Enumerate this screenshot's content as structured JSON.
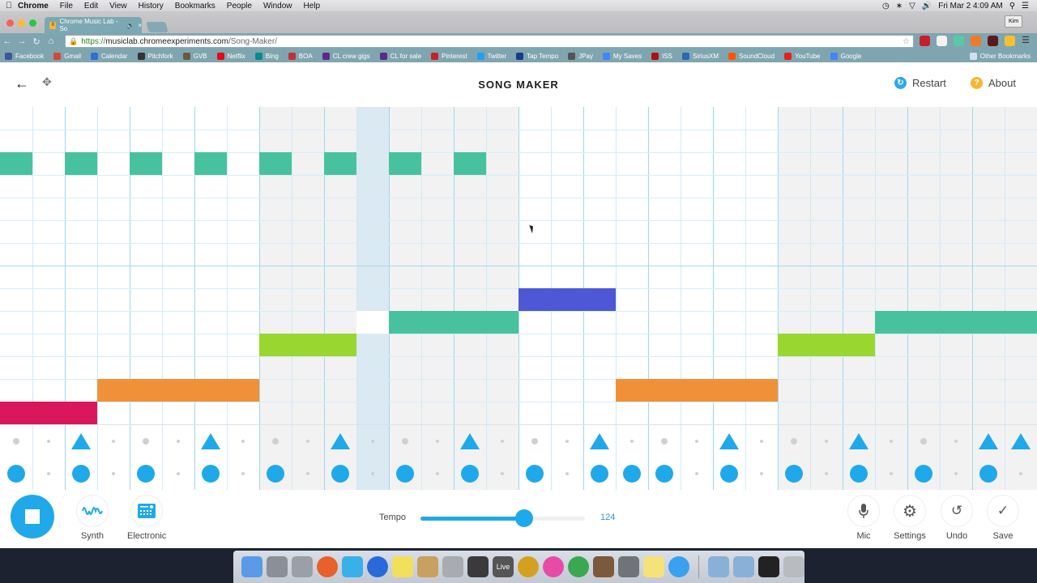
{
  "menubar": {
    "app_name": "Chrome",
    "items": [
      "File",
      "Edit",
      "View",
      "History",
      "Bookmarks",
      "People",
      "Window",
      "Help"
    ],
    "clock": "Fri Mar 2  4:09 AM"
  },
  "browser": {
    "tab_title": "Chrome Music Lab - So",
    "profile_name": "Kim",
    "url_scheme": "https://",
    "url_host": "musiclab.chromeexperiments.com",
    "url_path": "/Song-Maker/",
    "bookmarks": [
      {
        "label": "Facebook",
        "color": "#3b5998"
      },
      {
        "label": "Gmail",
        "color": "#d44638"
      },
      {
        "label": "Calendar",
        "color": "#2f6fd6"
      },
      {
        "label": "Pitchfork",
        "color": "#333333"
      },
      {
        "label": "GVB",
        "color": "#6b5a40"
      },
      {
        "label": "Netflix",
        "color": "#e50914"
      },
      {
        "label": "Bing",
        "color": "#0a8a8a"
      },
      {
        "label": "BOA",
        "color": "#c0303a"
      },
      {
        "label": "CL crew gigs",
        "color": "#5a2a8a"
      },
      {
        "label": "CL for sale",
        "color": "#5a2a8a"
      },
      {
        "label": "Pinterest",
        "color": "#cb2027"
      },
      {
        "label": "Twitter",
        "color": "#1da1f2"
      },
      {
        "label": "Tap Tempo",
        "color": "#1a3a8a"
      },
      {
        "label": "JPay",
        "color": "#555555"
      },
      {
        "label": "My Saves",
        "color": "#4285f4"
      },
      {
        "label": "ISS",
        "color": "#b01010"
      },
      {
        "label": "SiriusXM",
        "color": "#2a6ab0"
      },
      {
        "label": "SoundCloud",
        "color": "#ff5500"
      },
      {
        "label": "YouTube",
        "color": "#e62117"
      },
      {
        "label": "Google",
        "color": "#4285f4"
      }
    ],
    "other_bookmarks": "Other Bookmarks"
  },
  "app": {
    "title": "SONG MAKER",
    "restart_label": "Restart",
    "about_label": "About",
    "restart_icon": "restart-icon",
    "about_icon": "question-icon"
  },
  "song": {
    "columns": 32,
    "melody_rows": 14,
    "playhead_column": 11,
    "notes": [
      {
        "row": 2,
        "start": 0,
        "length": 1,
        "color": "#48c29e"
      },
      {
        "row": 2,
        "start": 2,
        "length": 1,
        "color": "#48c29e"
      },
      {
        "row": 2,
        "start": 4,
        "length": 1,
        "color": "#48c29e"
      },
      {
        "row": 2,
        "start": 6,
        "length": 1,
        "color": "#48c29e"
      },
      {
        "row": 2,
        "start": 8,
        "length": 1,
        "color": "#48c29e"
      },
      {
        "row": 2,
        "start": 10,
        "length": 1,
        "color": "#48c29e"
      },
      {
        "row": 2,
        "start": 12,
        "length": 1,
        "color": "#48c29e"
      },
      {
        "row": 2,
        "start": 14,
        "length": 1,
        "color": "#48c29e"
      },
      {
        "row": 8,
        "start": 16,
        "length": 3,
        "color": "#4e57d6"
      },
      {
        "row": 9,
        "start": 12,
        "length": 4,
        "color": "#48c29e"
      },
      {
        "row": 9,
        "start": 27,
        "length": 5,
        "color": "#48c29e"
      },
      {
        "row": 10,
        "start": 8,
        "length": 3,
        "color": "#9ad630"
      },
      {
        "row": 10,
        "start": 24,
        "length": 3,
        "color": "#9ad630"
      },
      {
        "row": 12,
        "start": 3,
        "length": 5,
        "color": "#f0913a"
      },
      {
        "row": 12,
        "start": 19,
        "length": 5,
        "color": "#f0913a"
      },
      {
        "row": 13,
        "start": 0,
        "length": 3,
        "color": "#d8185a"
      }
    ],
    "percussion_triangle_cols": [
      2,
      6,
      10,
      14,
      18,
      22,
      26,
      30,
      31
    ],
    "percussion_circle_cols": [
      0,
      2,
      4,
      6,
      8,
      10,
      12,
      14,
      16,
      18,
      19,
      20,
      22,
      24,
      26,
      28,
      30
    ]
  },
  "controls": {
    "play_state": "playing",
    "instrument_label": "Synth",
    "percussion_label": "Electronic",
    "tempo_label": "Tempo",
    "tempo_value": "124",
    "tempo_fraction": 0.63,
    "mic_label": "Mic",
    "settings_label": "Settings",
    "undo_label": "Undo",
    "save_label": "Save"
  }
}
